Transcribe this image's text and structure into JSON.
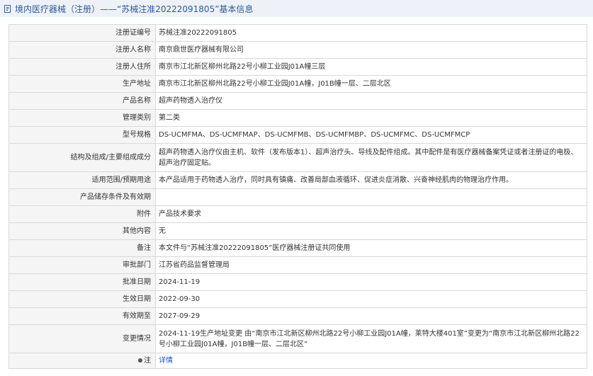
{
  "header": {
    "icon": "document-icon",
    "title": "境内医疗器械（注册）——“苏械注准20222091805”基本信息",
    "accent_color": "#2d5a9b"
  },
  "rows": [
    {
      "label": "注册证编号",
      "value": "苏械注准20222091805"
    },
    {
      "label": "注册人名称",
      "value": "南京鼎世医疗器械有限公司"
    },
    {
      "label": "注册人住所",
      "value": "南京市江北新区柳州北路22号小柳工业园J01A幢三层"
    },
    {
      "label": "生产地址",
      "value": "南京市江北新区柳州北路22号小柳工业园J01A幢，J01B幢一层、二层北区"
    },
    {
      "label": "产品名称",
      "value": "超声药物透入治疗仪"
    },
    {
      "label": "管理类别",
      "value": "第二类"
    },
    {
      "label": "型号规格",
      "value": "DS-UCMFMA、DS-UCMFMAP、DS-UCMFMB、DS-UCMFMBP、DS-UCMFMC、DS-UCMFMCP"
    },
    {
      "label": "结构及组成/主要组成成分",
      "value": "超声药物透入治疗仪由主机、软件（发布版本1）、超声治疗头、导线及配件组成。其中配件是有医疗器械备案凭证或者注册证的电极、超声治疗固定贴。"
    },
    {
      "label": "适用范围/预期用途",
      "value": "本产品适用于药物透入治疗，同时具有镇痛、改善局部血液循环、促进炎症消散、兴奋神经肌肉的物理治疗作用。"
    },
    {
      "label": "产品储存条件及有效期",
      "value": ""
    },
    {
      "label": "附件",
      "value": "产品技术要求"
    },
    {
      "label": "其他内容",
      "value": "无"
    },
    {
      "label": "备注",
      "value": "本文件与“苏械注准20222091805”医疗器械注册证共同使用"
    },
    {
      "label": "审批部门",
      "value": "江苏省药品监督管理局"
    },
    {
      "label": "批准日期",
      "value": "2024-11-19"
    },
    {
      "label": "生效日期",
      "value": "2022-09-30"
    },
    {
      "label": "有效期至",
      "value": "2027-09-29"
    },
    {
      "label": "变更情况",
      "value": "2024-11-19生产地址变更 由“南京市江北新区柳州北路22号小柳工业园J01A幢，莱特大楼401室”变更为“南京市江北新区柳州北路22号小柳工业园J01A幢，J01B幢一层、二层北区”"
    }
  ],
  "footer_row": {
    "label": "注",
    "link": "详情",
    "link_color": "#1a56b8"
  }
}
